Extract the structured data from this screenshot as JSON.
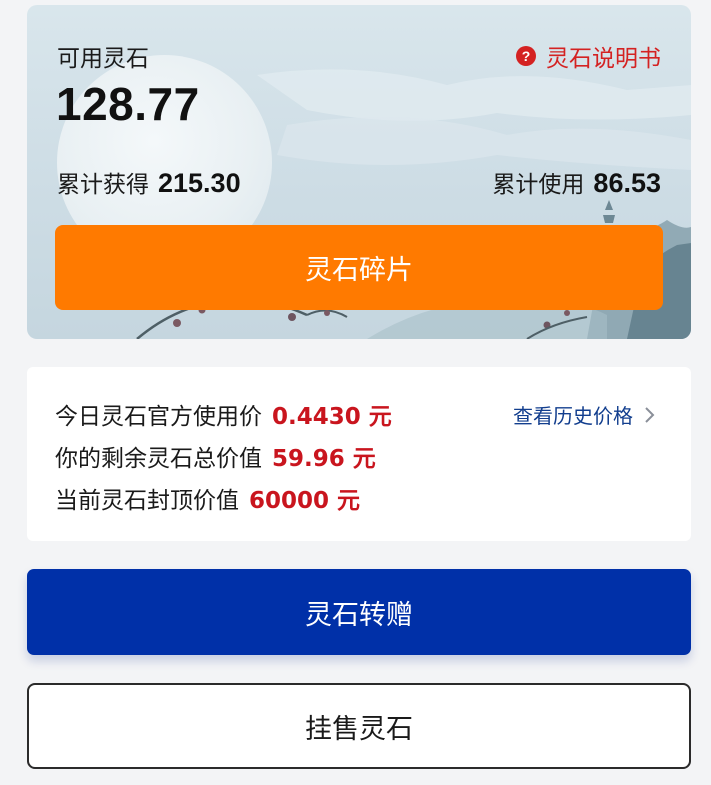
{
  "balance": {
    "available_label": "可用灵石",
    "available_amount": "128.77",
    "manual_link": "灵石说明书",
    "help_icon": "?",
    "earned_label": "累计获得",
    "earned_value": "215.30",
    "used_label": "累计使用",
    "used_value": "86.53",
    "fragment_button": "灵石碎片"
  },
  "price": {
    "official_price_label": "今日灵石官方使用价",
    "official_price_value": "0.4430 元",
    "remaining_value_label": "你的剩余灵石总价值",
    "remaining_value_value": "59.96 元",
    "cap_value_label": "当前灵石封顶价值",
    "cap_value_value": "60000 元",
    "history_link": "查看历史价格"
  },
  "actions": {
    "gift_button": "灵石转赠",
    "sell_button": "挂售灵石"
  },
  "colors": {
    "orange": "#ff7a00",
    "blue": "#0030a8",
    "red": "#c9151e",
    "link_blue": "#123e8e"
  }
}
